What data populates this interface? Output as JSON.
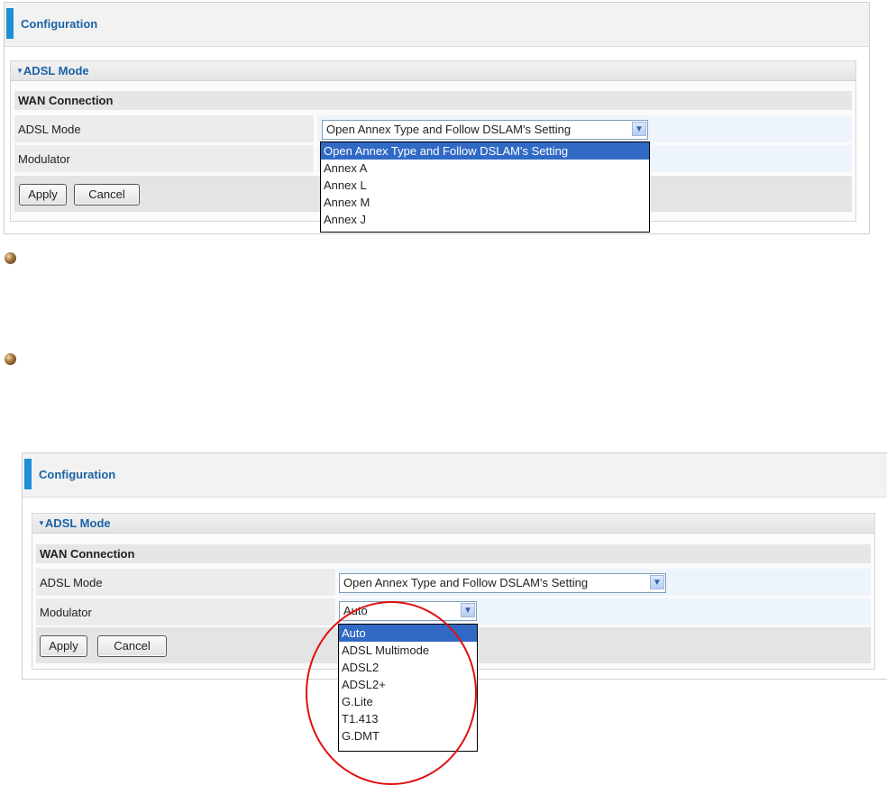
{
  "screen1": {
    "config_title": "Configuration",
    "section_title": "ADSL Mode",
    "subsection_title": "WAN Connection",
    "adsl_mode_label": "ADSL Mode",
    "modulator_label": "Modulator",
    "adsl_mode_value": "Open Annex Type and Follow DSLAM's Setting",
    "adsl_options": [
      "Open Annex Type and Follow DSLAM's Setting",
      "Annex A",
      "Annex L",
      "Annex M",
      "Annex J"
    ],
    "apply_label": "Apply",
    "cancel_label": "Cancel"
  },
  "screen2": {
    "config_title": "Configuration",
    "section_title": "ADSL Mode",
    "subsection_title": "WAN Connection",
    "adsl_mode_label": "ADSL Mode",
    "modulator_label": "Modulator",
    "adsl_mode_value": "Open Annex Type and Follow DSLAM's Setting",
    "modulator_value": "Auto",
    "modulator_options": [
      "Auto",
      "ADSL Multimode",
      "ADSL2",
      "ADSL2+",
      "G.Lite",
      "T1.413",
      "G.DMT"
    ],
    "apply_label": "Apply",
    "cancel_label": "Cancel"
  },
  "icons": {
    "triangle": "triangle-down-icon",
    "dropdown_arrow": "chevron-down-icon",
    "bullet": "bullet-icon"
  },
  "colors": {
    "accent": "#1c8fd6",
    "title_blue": "#1b63a6",
    "selection": "#316ac5",
    "highlight_circle": "#e01010"
  }
}
